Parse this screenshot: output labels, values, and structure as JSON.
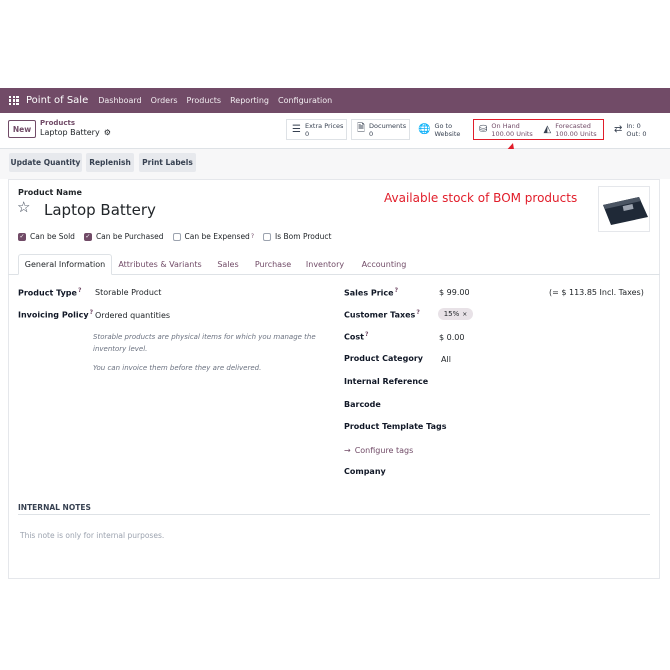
{
  "navbar": {
    "brand": "Point of Sale",
    "items": [
      "Dashboard",
      "Orders",
      "Products",
      "Reporting",
      "Configuration"
    ],
    "color": "#714b67"
  },
  "control_panel": {
    "new_label": "New",
    "breadcrumb_parent": "Products",
    "record_name": "Laptop Battery",
    "smart_buttons": {
      "extra_prices": {
        "label": "Extra Prices",
        "value": "0"
      },
      "documents": {
        "label": "Documents",
        "value": "0"
      },
      "website": {
        "line1": "Go to",
        "line2": "Website"
      },
      "on_hand": {
        "label": "On Hand",
        "value": "100.00 Units"
      },
      "forecasted": {
        "label": "Forecasted",
        "value": "100.00 Units"
      },
      "in_out": {
        "in": "In: 0",
        "out": "Out: 0"
      }
    }
  },
  "actions": {
    "update_quantity": "Update Quantity",
    "replenish": "Replenish",
    "print_labels": "Print Labels"
  },
  "annotation": {
    "text": "Available stock of BOM products",
    "color": "#e11d2a"
  },
  "product": {
    "name_label": "Product Name",
    "name": "Laptop Battery",
    "checkboxes": [
      {
        "label": "Can be Sold",
        "checked": true
      },
      {
        "label": "Can be Purchased",
        "checked": true
      },
      {
        "label": "Can be Expensed",
        "checked": false
      },
      {
        "label": "Is Bom Product",
        "checked": false
      }
    ]
  },
  "tabs": [
    "General Information",
    "Attributes & Variants",
    "Sales",
    "Purchase",
    "Inventory",
    "Accounting"
  ],
  "left_fields": {
    "product_type_label": "Product Type",
    "product_type_value": "Storable Product",
    "invoicing_policy_label": "Invoicing Policy",
    "invoicing_policy_value": "Ordered quantities",
    "note1": "Storable products are physical items for which you manage the inventory level.",
    "note2": "You can invoice them before they are delivered."
  },
  "right_fields": {
    "sales_price_label": "Sales Price",
    "sales_price_value": "$ 99.00",
    "sales_price_incl": "(= $ 113.85 Incl. Taxes)",
    "customer_taxes_label": "Customer Taxes",
    "customer_taxes_badge": "15%",
    "cost_label": "Cost",
    "cost_value": "$ 0.00",
    "product_category_label": "Product Category",
    "product_category_value": "All",
    "internal_reference_label": "Internal Reference",
    "barcode_label": "Barcode",
    "product_template_tags_label": "Product Template Tags",
    "configure_tags": "Configure tags",
    "company_label": "Company"
  },
  "internal_notes": {
    "title": "INTERNAL NOTES",
    "placeholder": "This note is only for internal purposes."
  }
}
